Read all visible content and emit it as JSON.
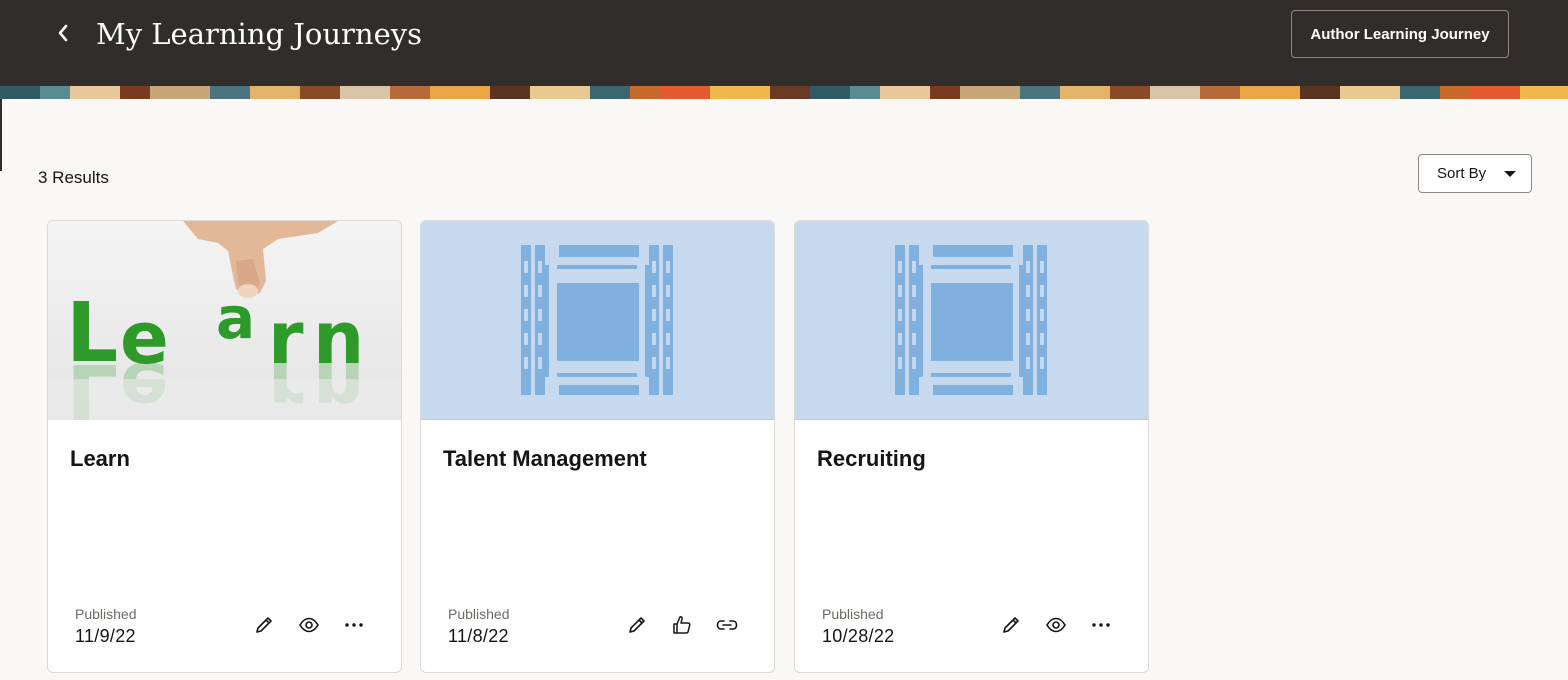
{
  "header": {
    "title": "My Learning Journeys",
    "author_button_label": "Author Learning Journey"
  },
  "results": {
    "count_label": "3 Results",
    "sort_label": "Sort By"
  },
  "cards": [
    {
      "title": "Learn",
      "status": "Published",
      "date": "11/9/22",
      "image_text": "Learn",
      "actions": [
        "edit-icon",
        "view-icon",
        "more-icon"
      ]
    },
    {
      "title": "Talent Management",
      "status": "Published",
      "date": "11/8/22",
      "actions": [
        "edit-icon",
        "like-icon",
        "link-icon"
      ]
    },
    {
      "title": "Recruiting",
      "status": "Published",
      "date": "10/28/22",
      "actions": [
        "edit-icon",
        "view-icon",
        "more-icon"
      ]
    }
  ],
  "colors": {
    "header_bg": "#312d2a",
    "placeholder_bg": "#c6d9ee",
    "placeholder_icon": "#80b0dd",
    "learn_green": "#2d9a2a"
  }
}
